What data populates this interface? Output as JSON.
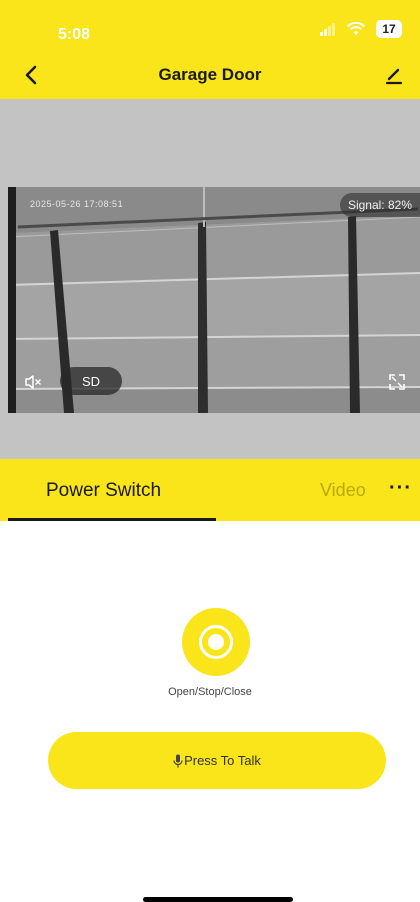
{
  "status_bar": {
    "time": "5:08",
    "battery": "17"
  },
  "header": {
    "title": "Garage Door"
  },
  "video": {
    "timestamp": "2025-05-26 17:08:51",
    "signal": "Signal: 82%",
    "quality_label": "SD"
  },
  "tabs": [
    {
      "label": "Power Switch",
      "active": true
    },
    {
      "label": "Video",
      "active": false
    }
  ],
  "tab_more": "···",
  "control": {
    "label": "Open/Stop/Close"
  },
  "talk_button": {
    "label": "Press To Talk"
  },
  "colors": {
    "brand_yellow": "#f9e51a",
    "video_background": "#c3c3c3",
    "inactive_tab_text": "#b8a90d"
  }
}
